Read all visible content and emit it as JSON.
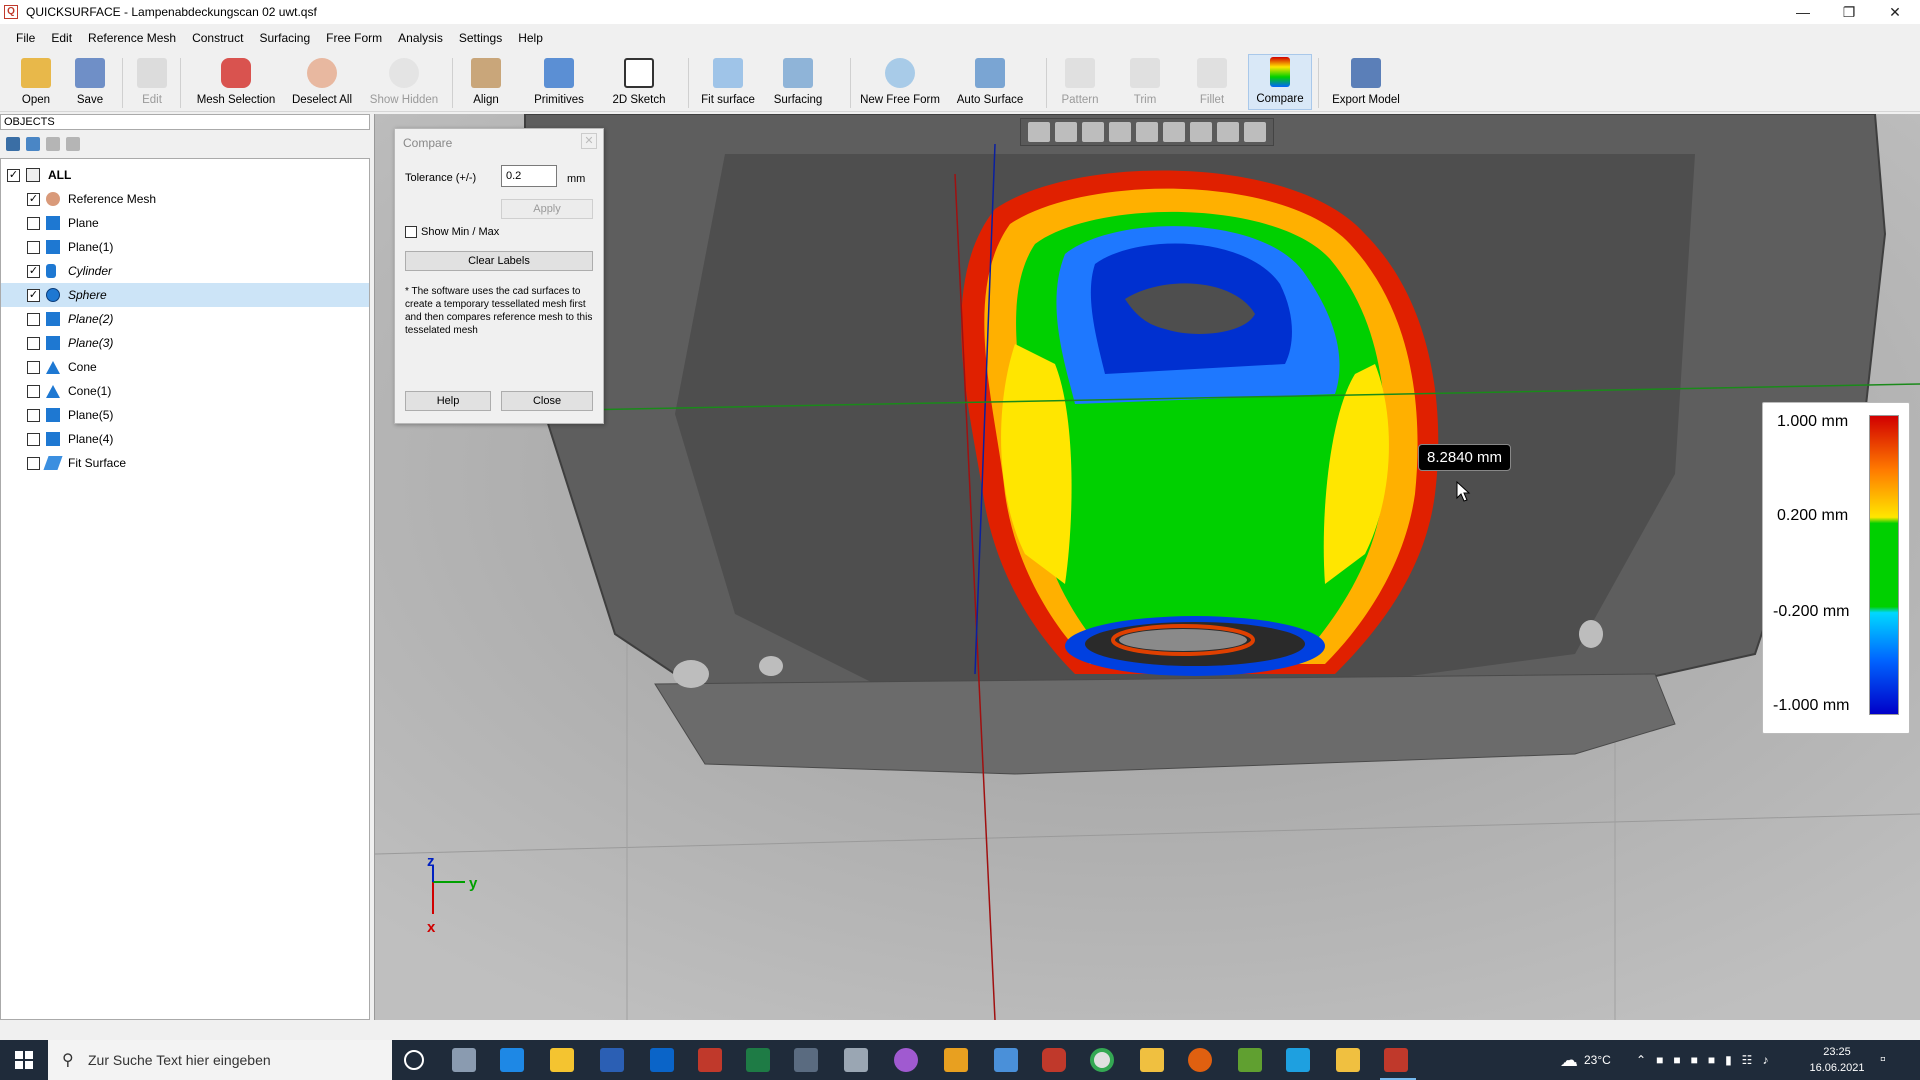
{
  "window": {
    "title": "QUICKSURFACE - Lampenabdeckungscan 02 uwt.qsf",
    "minimize_icon": "minimize-icon",
    "maximize_icon": "restore-icon",
    "close_icon": "close-icon"
  },
  "menu": [
    "File",
    "Edit",
    "Reference Mesh",
    "Construct",
    "Surfacing",
    "Free Form",
    "Analysis",
    "Settings",
    "Help"
  ],
  "toolbar": {
    "open": "Open",
    "save": "Save",
    "edit": "Edit",
    "mesh_selection": "Mesh Selection",
    "deselect_all": "Deselect All",
    "show_hidden": "Show Hidden",
    "align": "Align",
    "primitives": "Primitives",
    "sketch2d": "2D Sketch",
    "fit_surface": "Fit surface",
    "surfacing": "Surfacing",
    "new_free_form": "New Free Form",
    "auto_surface": "Auto Surface",
    "pattern": "Pattern",
    "trim": "Trim",
    "fillet": "Fillet",
    "compare": "Compare",
    "export_model": "Export Model"
  },
  "objects_panel": {
    "header": "OBJECTS",
    "items": [
      {
        "label": "ALL",
        "checked": true,
        "icon": "list-icon",
        "bold": true
      },
      {
        "label": "Reference Mesh",
        "checked": true,
        "icon": "mesh-icon"
      },
      {
        "label": "Plane",
        "checked": false,
        "icon": "plane-icon"
      },
      {
        "label": "Plane(1)",
        "checked": false,
        "icon": "plane-icon"
      },
      {
        "label": "Cylinder",
        "checked": true,
        "icon": "cylinder-icon",
        "italic": true
      },
      {
        "label": "Sphere",
        "checked": true,
        "icon": "sphere-icon",
        "italic": true,
        "selected": true
      },
      {
        "label": "Plane(2)",
        "checked": false,
        "icon": "plane-icon",
        "italic": true
      },
      {
        "label": "Plane(3)",
        "checked": false,
        "icon": "plane-icon",
        "italic": true
      },
      {
        "label": "Cone",
        "checked": false,
        "icon": "cone-icon"
      },
      {
        "label": "Cone(1)",
        "checked": false,
        "icon": "cone-icon"
      },
      {
        "label": "Plane(5)",
        "checked": false,
        "icon": "plane-icon"
      },
      {
        "label": "Plane(4)",
        "checked": false,
        "icon": "plane-icon"
      },
      {
        "label": "Fit Surface",
        "checked": false,
        "icon": "surface-icon"
      }
    ]
  },
  "compare_dialog": {
    "title": "Compare",
    "tolerance_label": "Tolerance (+/-)",
    "tolerance_value": "0.2",
    "unit": "mm",
    "apply": "Apply",
    "show_minmax": "Show Min / Max",
    "clear_labels": "Clear Labels",
    "note": "* The software uses the cad surfaces to create a temporary tessellated mesh first and then compares reference mesh to this tesselated mesh",
    "help": "Help",
    "close": "Close"
  },
  "viewport": {
    "tooltip": "8.2840 mm",
    "axis_z": "z",
    "axis_y": "y",
    "axis_x": "x"
  },
  "legend": {
    "labels": [
      "1.000 mm",
      "0.200 mm",
      "-0.200 mm",
      "-1.000 mm"
    ]
  },
  "taskbar": {
    "search_placeholder": "Zur Suche Text hier eingeben",
    "temperature": "23°C",
    "time": "23:25",
    "date": "16.06.2021"
  },
  "colors": {
    "accent": "#0078d7",
    "deviation_red": "#d10000",
    "deviation_green": "#00d000",
    "deviation_blue": "#0000c8"
  }
}
